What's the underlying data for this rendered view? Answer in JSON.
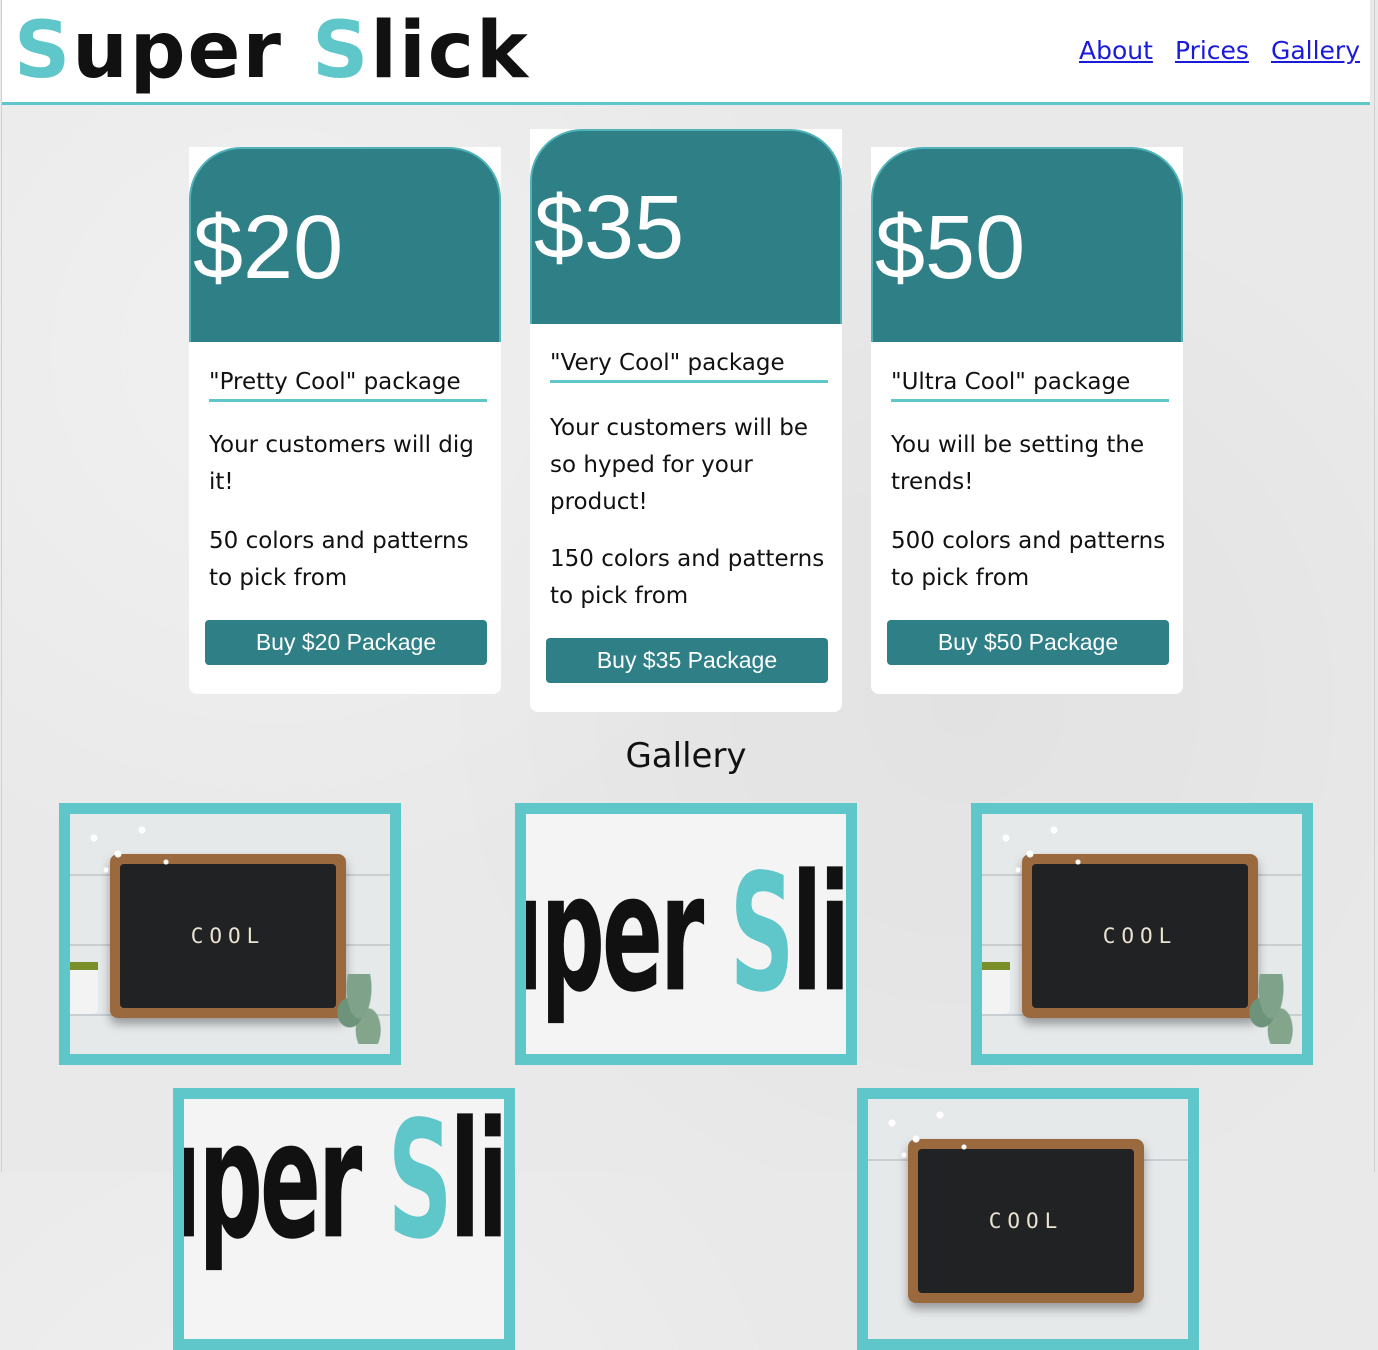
{
  "header": {
    "logo_part1": "S",
    "logo_part2": "uper ",
    "logo_part3": "S",
    "logo_part4": "lick",
    "nav": [
      "About",
      "Prices",
      "Gallery"
    ]
  },
  "packages": [
    {
      "price": "$20",
      "title": "\"Pretty Cool\" package",
      "desc": "Your customers will dig it!",
      "features": "50 colors and patterns to pick from",
      "button": "Buy $20 Package"
    },
    {
      "price": "$35",
      "title": "\"Very Cool\" package",
      "desc": "Your customers will be so hyped for your product!",
      "features": "150 colors and patterns to pick from",
      "button": "Buy $35 Package"
    },
    {
      "price": "$50",
      "title": "\"Ultra Cool\" package",
      "desc": "You will be setting the trends!",
      "features": "500 colors and patterns to pick from",
      "button": "Buy $50 Package"
    }
  ],
  "gallery": {
    "title": "Gallery",
    "photo_text": "COOL",
    "logo_part1": "S",
    "logo_part2": "uper ",
    "logo_part3": "S",
    "logo_part4": "lick"
  },
  "colors": {
    "accent": "#5fc6ca",
    "card_head": "#2e7f86",
    "link": "#1a1adb"
  }
}
